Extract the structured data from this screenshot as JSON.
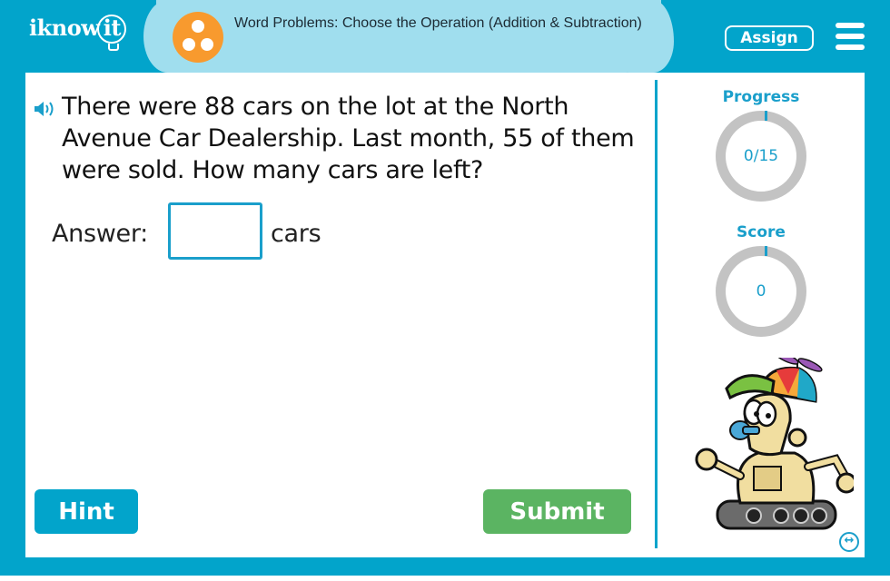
{
  "header": {
    "logo": {
      "prefix": "iknow",
      "suffix": "it"
    },
    "topic_title": "Word Problems: Choose the Operation (Addition & Subtraction)",
    "assign_label": "Assign",
    "menu_icon": "hamburger-icon",
    "topic_icon": "three-dots-circle-icon"
  },
  "question": {
    "audio_icon": "speaker-icon",
    "text": "There were 88 cars on the lot at the North Avenue Car Dealership. Last month, 55 of them were sold. How many cars are left?",
    "answer_label": "Answer:",
    "answer_value": "",
    "answer_placeholder": "",
    "unit": "cars"
  },
  "actions": {
    "hint_label": "Hint",
    "submit_label": "Submit"
  },
  "sidebar": {
    "progress": {
      "label": "Progress",
      "value": "0/15",
      "completed": 0,
      "total": 15
    },
    "score": {
      "label": "Score",
      "value": "0"
    },
    "mascot": "robot-mascot-with-propeller-cap",
    "expand_icon": "expand-arrows-icon"
  },
  "colors": {
    "brand": "#02a4cb",
    "header_pill": "#a0deee",
    "topic_icon": "#f89a2e",
    "submit": "#5bb462",
    "ring": "#c3c3c3"
  }
}
